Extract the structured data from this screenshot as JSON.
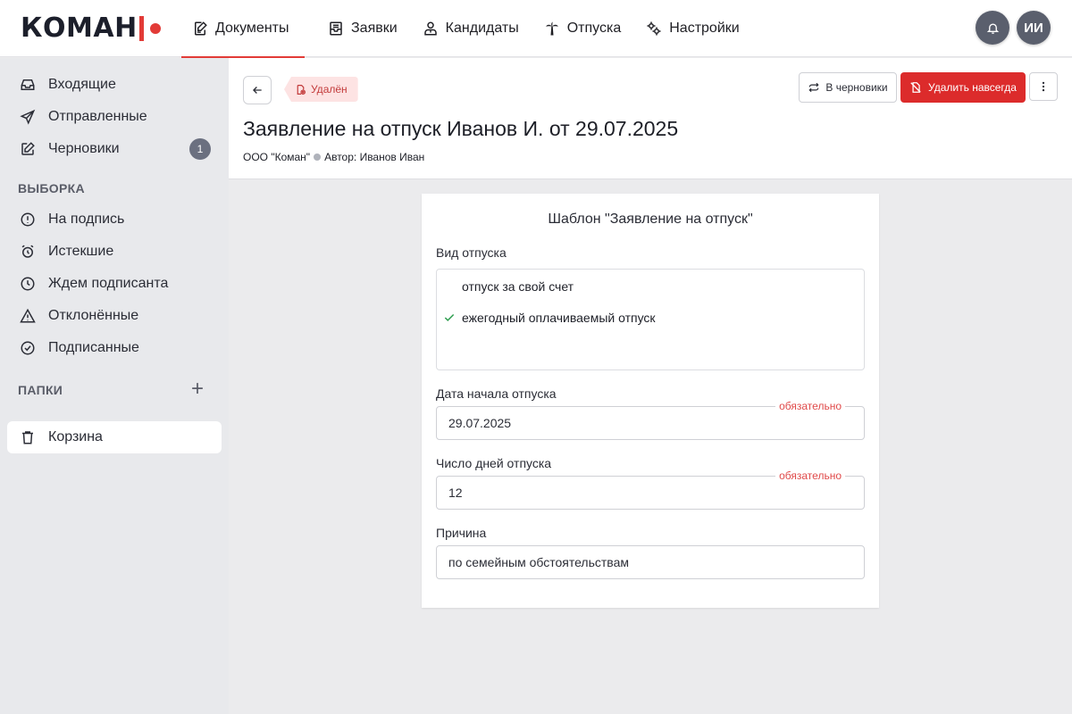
{
  "brand": {
    "name": "КОМАН",
    "accent": "#e23b37"
  },
  "nav": [
    {
      "label": "Документы",
      "icon": "document-sign-icon",
      "active": true
    },
    {
      "label": "Заявки",
      "icon": "inbox-tray-icon"
    },
    {
      "label": "Кандидаты",
      "icon": "person-badge-icon"
    },
    {
      "label": "Отпуска",
      "icon": "palm-tree-icon"
    },
    {
      "label": "Настройки",
      "icon": "gears-icon"
    }
  ],
  "user": {
    "initials": "ИИ"
  },
  "sidebar": {
    "items": [
      {
        "label": "Входящие",
        "icon": "inbox-icon"
      },
      {
        "label": "Отправленные",
        "icon": "send-icon"
      },
      {
        "label": "Черновики",
        "icon": "edit-icon",
        "count": "1"
      }
    ],
    "filters_title": "ВЫБОРКА",
    "filters": [
      {
        "label": "На подпись",
        "icon": "exclamation-circle-icon"
      },
      {
        "label": "Истекшие",
        "icon": "alarm-clock-icon"
      },
      {
        "label": "Ждем подписанта",
        "icon": "clock-icon"
      },
      {
        "label": "Отклонённые",
        "icon": "warning-triangle-icon"
      },
      {
        "label": "Подписанные",
        "icon": "check-circle-icon"
      }
    ],
    "folders_title": "ПАПКИ",
    "trash_label": "Корзина"
  },
  "document": {
    "status": "Удалён",
    "title": "Заявление на отпуск Иванов И. от 29.07.2025",
    "org": "ООО \"Коман\"",
    "author": "Автор: Иванов Иван",
    "actions": {
      "to_drafts": "В черновики",
      "delete_forever": "Удалить навсегда"
    }
  },
  "form": {
    "title": "Шаблон \"Заявление на отпуск\"",
    "vacation_type": {
      "label": "Вид отпуска",
      "options": [
        "отпуск за свой счет",
        "ежегодный оплачиваемый отпуск"
      ],
      "selected": "ежегодный оплачиваемый отпуск"
    },
    "start_date": {
      "label": "Дата начала отпуска",
      "value": "29.07.2025",
      "required": "обязательно"
    },
    "days": {
      "label": "Число дней отпуска",
      "value": "12",
      "required": "обязательно"
    },
    "reason": {
      "label": "Причина",
      "value": "по семейным обстоятельствам"
    }
  }
}
